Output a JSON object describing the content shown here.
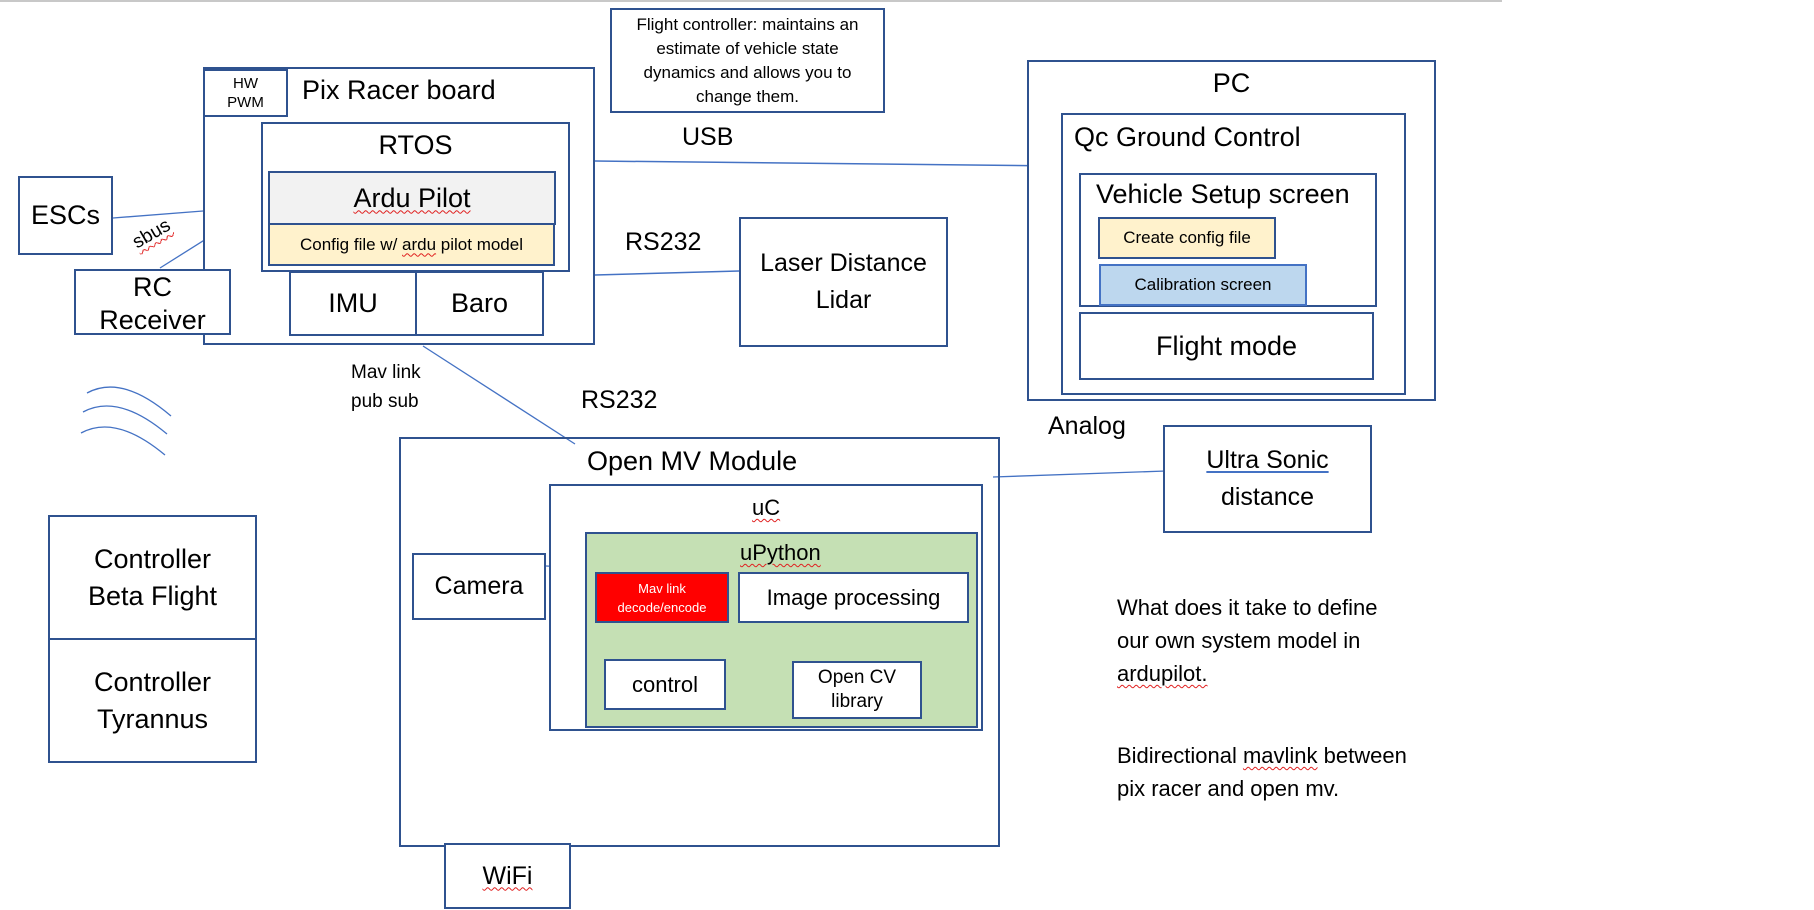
{
  "note": {
    "flight_controller": "Flight controller: maintains an estimate of vehicle state dynamics and allows you to change them."
  },
  "pixracer": {
    "title": "Pix Racer board",
    "hw_pwm_line1": "HW",
    "hw_pwm_line2": "PWM",
    "rtos": "RTOS",
    "ardupilot": "Ardu Pilot",
    "config_prefix": "Config file w/ ",
    "config_squiggle": "ardu",
    "config_suffix": " pilot model",
    "imu": "IMU",
    "baro": "Baro"
  },
  "peripherals": {
    "escs": "ESCs",
    "rc_line1": "RC",
    "rc_line2": "Receiver",
    "sbus": "sbus",
    "laser_line1": "Laser Distance",
    "laser_line2": "Lidar",
    "ultrasonic_line1": "Ultra Sonic",
    "ultrasonic_line2": "distance"
  },
  "links": {
    "usb": "USB",
    "rs232_lidar": "RS232",
    "rs232_openmv": "RS232",
    "mavlink_line1": "Mav link",
    "mavlink_line2": "pub sub",
    "analog": "Analog"
  },
  "pc": {
    "title": "PC",
    "qgc": "Qc Ground Control",
    "vehicle_setup": "Vehicle Setup screen",
    "create_config": "Create config file",
    "calibration": "Calibration screen",
    "flight_mode": "Flight mode"
  },
  "controllers": {
    "beta_line1": "Controller",
    "beta_line2": "Beta Flight",
    "tyr_line1": "Controller",
    "tyr_line2": "Tyrannus"
  },
  "openmv": {
    "title": "Open MV Module",
    "uc": "uC",
    "upython": "uPython",
    "camera": "Camera",
    "mavlink_line1": "Mav link",
    "mavlink_line2": "decode/encode",
    "image_processing": "Image processing",
    "control": "control",
    "opencv_line1": "Open CV",
    "opencv_line2": "library",
    "wifi": "WiFi"
  },
  "notes": {
    "q1_line1": "What does it take to define",
    "q1_line2": "our own system model in",
    "q1_line3": "ardupilot.",
    "q2_line1_a": "Bidirectional ",
    "q2_line1_b": "mavlink",
    "q2_line1_c": " between",
    "q2_line2": "pix racer and open mv."
  },
  "colors": {
    "border": "#2f528f",
    "connector": "#4472c4",
    "ardupilot_fill": "#f2f2f2",
    "config_fill": "#fff2cc",
    "calibration_fill": "#bdd7ee",
    "upython_fill": "#c5e0b4",
    "mavlink_fill": "#ff0000"
  }
}
